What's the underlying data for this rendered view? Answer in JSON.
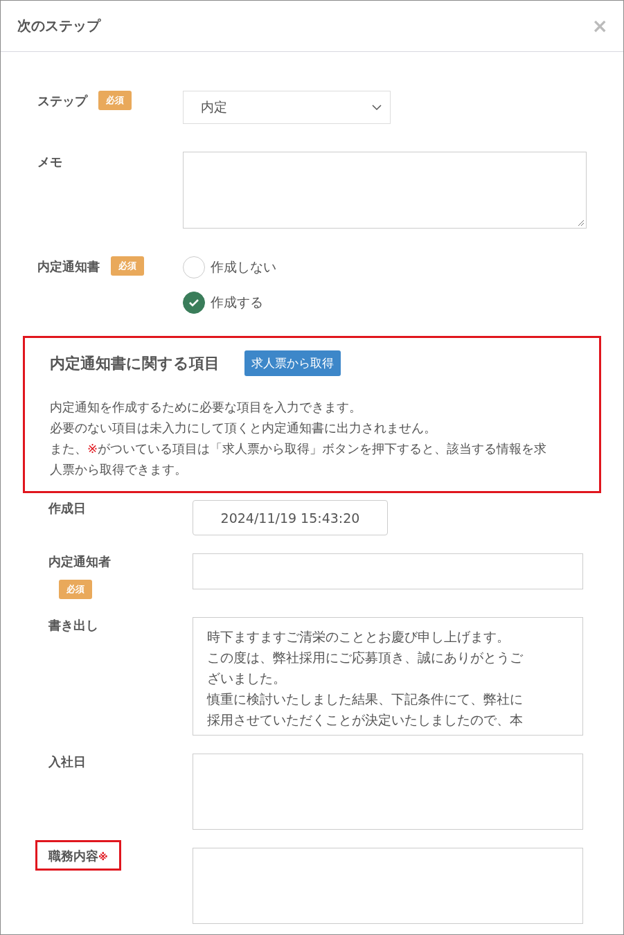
{
  "dialog": {
    "title": "次のステップ",
    "close": "×"
  },
  "fields": [
    {
      "label": "ステップ",
      "badge": "必須",
      "kind": "select",
      "value": "内定"
    },
    {
      "label": "メモ",
      "kind": "textarea"
    },
    {
      "label": "内定通知書",
      "badge": "必須",
      "kind": "radio",
      "options": [
        {
          "label": "作成しない",
          "selected": false
        },
        {
          "label": "作成する",
          "selected": true
        }
      ]
    }
  ],
  "offer_section": {
    "title": "内定通知書に関する項目",
    "button": "求人票から取得",
    "highlighted": true,
    "description": [
      [
        {
          "text": "内定通知を作成するために必要な項目を入力できます。"
        }
      ],
      [
        {
          "text": "必要のない項目は未入力にして頂くと内定通知書に出力されません。"
        }
      ],
      [
        {
          "text": "また、"
        },
        {
          "text": "※",
          "kind": "note_mark"
        },
        {
          "text": "がついている項目は「求人票から取得」ボタンを押下すると、該当する情報を求"
        }
      ],
      [
        {
          "text": "人票から取得できます。"
        }
      ]
    ]
  },
  "offer_fields": [
    {
      "label": "作成日",
      "kind": "date",
      "value": "2024/11/19 15:43:20"
    },
    {
      "label": "内定通知者",
      "badge": "必須",
      "kind": "input"
    },
    {
      "label": "書き出し",
      "kind": "textarea",
      "lines": [
        "時下ますますご清栄のこととお慶び申し上げます。",
        "この度は、弊社採用にご応募頂き、誠にありがとうご",
        "ざいました。",
        "慎重に検討いたしました結果、下記条件にて、弊社に",
        "採用させていただくことが決定いたしましたので、本"
      ]
    },
    {
      "label": "入社日",
      "kind": "textarea"
    },
    {
      "label": "職務内容",
      "note_mark": "※",
      "highlighted": true,
      "kind": "textarea"
    }
  ]
}
